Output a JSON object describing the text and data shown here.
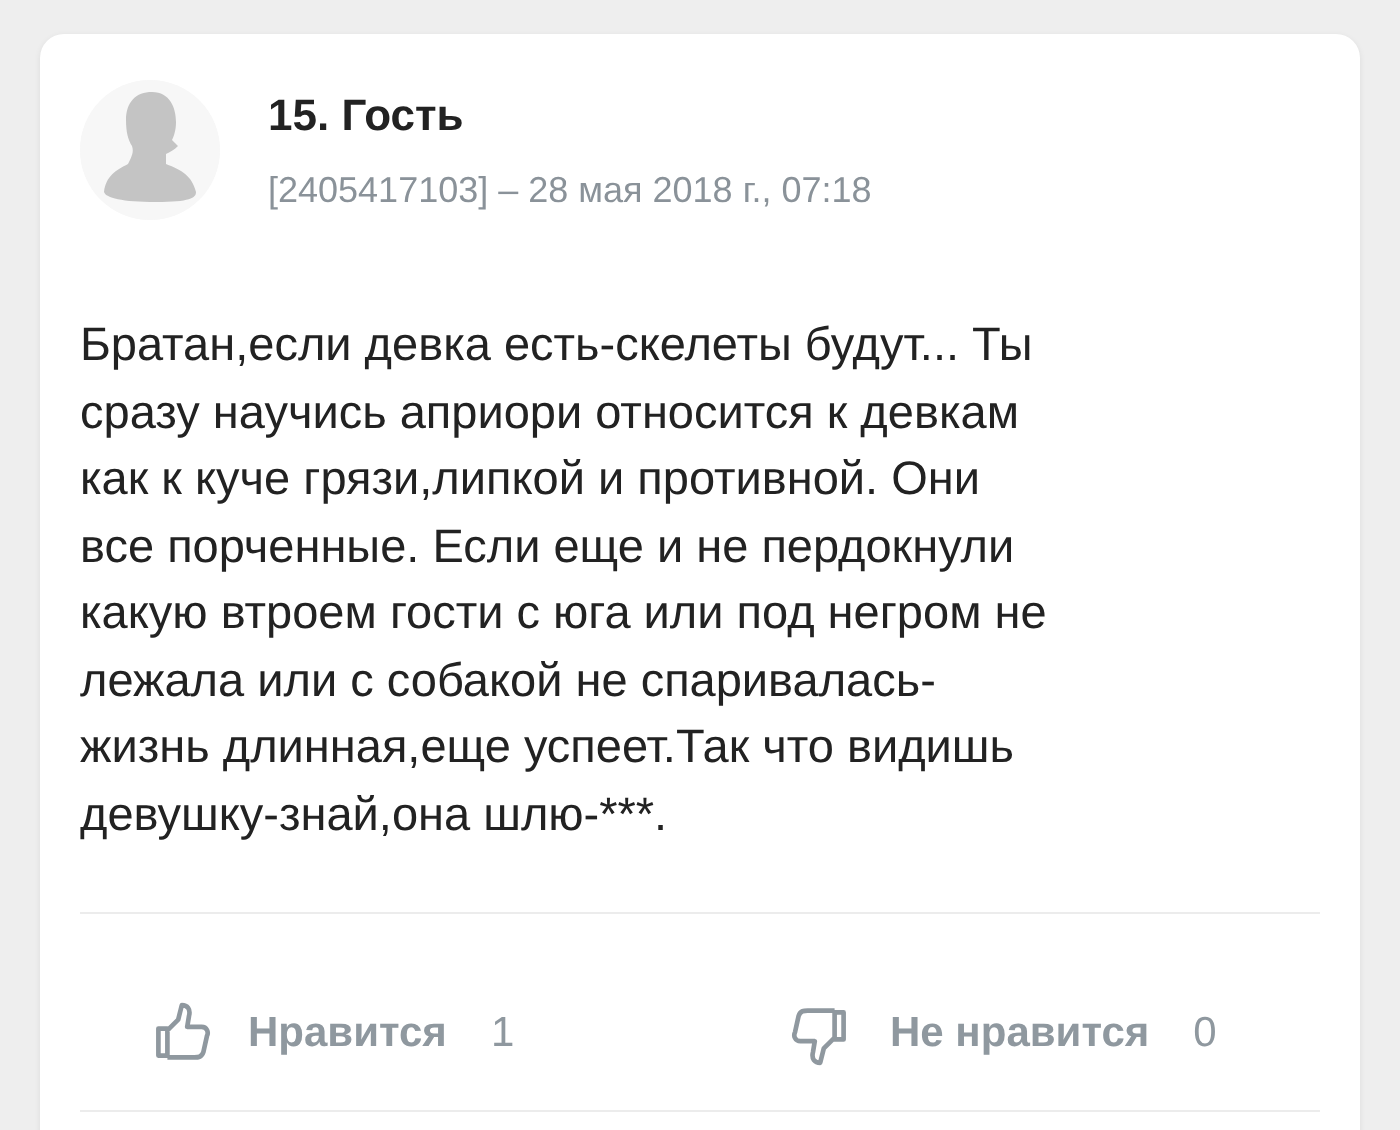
{
  "comment": {
    "author": "15. Гость",
    "meta": "[2405417103] – 28 мая 2018 г., 07:18",
    "text_lines": [
      "Братан,если девка есть-скелеты будут... Ты",
      "сразу научись априори относится к девкам",
      "как к куче грязи,липкой и противной. Они",
      "все порченные. Если еще и не пердокнули",
      "какую втроем гости с юга или под негром не",
      "лежала или с собакой не спаривалась-",
      "жизнь длинная,еще успеет.Так что видишь",
      "девушку-знай,она шлю-***."
    ],
    "reactions": [
      {
        "kind": "like",
        "label": "Нравится",
        "count": "1"
      },
      {
        "kind": "dislike",
        "label": "Не нравится",
        "count": "0"
      }
    ]
  }
}
